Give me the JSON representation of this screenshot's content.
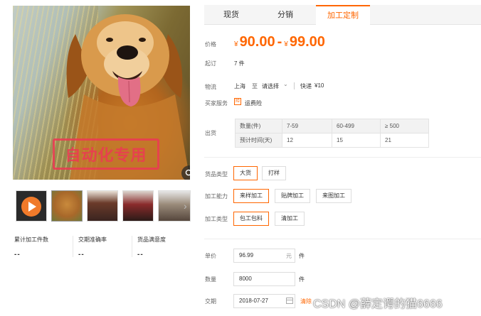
{
  "product": {
    "watermark_text": "自动化专用",
    "zoom_icon": "magnifier-icon",
    "thumbnails": [
      "video",
      "dog",
      "woman-coat-1",
      "woman-coat-2",
      "woman-coat-3"
    ]
  },
  "stats": {
    "cumulative_label": "累计加工件数",
    "cumulative_value": "--",
    "delivery_label": "交期准确率",
    "delivery_value": "--",
    "satisfaction_label": "货品满意度",
    "satisfaction_value": "--"
  },
  "tabs": [
    "现货",
    "分销",
    "加工定制"
  ],
  "active_tab": 2,
  "price": {
    "label": "价格",
    "currency": "¥",
    "low": "90.00",
    "dash": "-",
    "high": "99.00"
  },
  "moq": {
    "label": "起订",
    "value": "7 件"
  },
  "logistics": {
    "label": "物流",
    "from": "上海",
    "to_word": "至",
    "select": "请选择",
    "express": "快递",
    "fee": "¥10"
  },
  "buyer_service": {
    "label": "买家服务",
    "icon_text": "险",
    "value": "运费险"
  },
  "shipping": {
    "label": "出货",
    "rows": [
      [
        "数量(件)",
        "7-59",
        "60-499",
        "≥ 500"
      ],
      [
        "预计时间(天)",
        "12",
        "15",
        "21"
      ]
    ]
  },
  "goods_type": {
    "label": "货品类型",
    "options": [
      "大货",
      "打样"
    ],
    "selected": 0
  },
  "capability": {
    "label": "加工能力",
    "options": [
      "来样加工",
      "贴牌加工",
      "来图加工"
    ],
    "selected": 0
  },
  "process_type": {
    "label": "加工类型",
    "options": [
      "包工包料",
      "清加工"
    ],
    "selected": 0
  },
  "unit_price": {
    "label": "单价",
    "value": "96.99",
    "unit_text": "元",
    "unit": "件"
  },
  "quantity": {
    "label": "数量",
    "value": "8000",
    "unit": "件"
  },
  "delivery": {
    "label": "交期",
    "value": "2018-07-27",
    "clear": "清除"
  },
  "footer_watermark": "CSDN @薛定谔的猫6666",
  "colors": {
    "accent": "#ff6600",
    "watermark": "#ec3854"
  }
}
